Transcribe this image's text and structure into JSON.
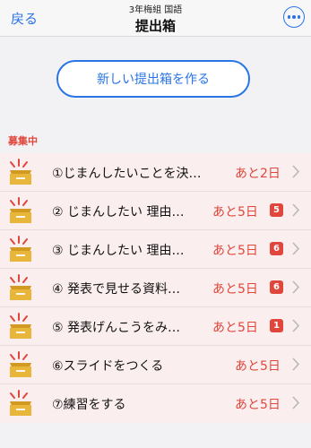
{
  "header": {
    "back_label": "戻る",
    "class_name": "3年梅組 国語",
    "title": "提出箱"
  },
  "create_button_label": "新しい提出箱を作る",
  "section_label": "募集中",
  "colors": {
    "accent": "#2a74e6",
    "alert": "#e0463c",
    "row_background": "#fbeeee",
    "box_icon": "#e7b63a"
  },
  "items": [
    {
      "title": "①じまんしたいことを決…",
      "deadline": "あと2日",
      "badge": ""
    },
    {
      "title": "② じまんしたい 理由…",
      "deadline": "あと5日",
      "badge": "5"
    },
    {
      "title": "③ じまんしたい 理由…",
      "deadline": "あと5日",
      "badge": "6"
    },
    {
      "title": "④ 発表で見せる資料…",
      "deadline": "あと5日",
      "badge": "6"
    },
    {
      "title": "⑤ 発表げんこうをみ…",
      "deadline": "あと5日",
      "badge": "1"
    },
    {
      "title": "⑥スライドをつくる",
      "deadline": "あと5日",
      "badge": ""
    },
    {
      "title": "⑦練習をする",
      "deadline": "あと5日",
      "badge": ""
    }
  ]
}
